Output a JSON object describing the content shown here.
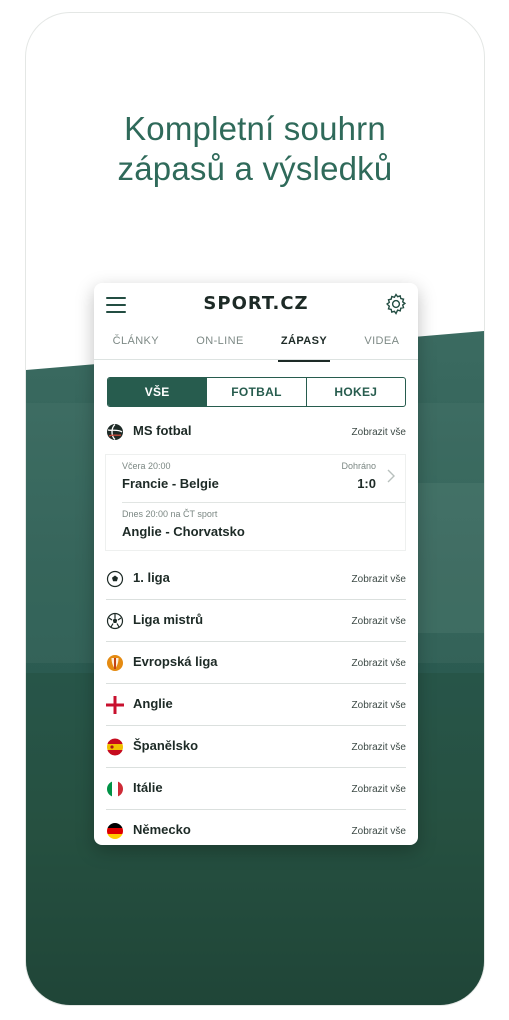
{
  "headline": {
    "line1": "Kompletní souhrn",
    "line2": "zápasů a výsledků"
  },
  "app": {
    "logo": "SPORT.CZ",
    "tabs": [
      {
        "label": "ČLÁNKY"
      },
      {
        "label": "ON-LINE"
      },
      {
        "label": "ZÁPASY"
      },
      {
        "label": "VIDEA"
      }
    ],
    "active_tab": "ZÁPASY",
    "segments": [
      {
        "label": "VŠE"
      },
      {
        "label": "FOTBAL"
      },
      {
        "label": "HOKEJ"
      }
    ],
    "active_segment": "VŠE",
    "featured": {
      "title": "MS fotbal",
      "link": "Zobrazit vše",
      "matches": [
        {
          "meta": "Včera 20:00",
          "teams": "Francie - Belgie",
          "status": "Dohráno",
          "score": "1:0"
        },
        {
          "meta": "Dnes 20:00 na ČT sport",
          "teams": "Anglie - Chorvatsko"
        }
      ]
    },
    "sections": [
      {
        "title": "1. liga",
        "link": "Zobrazit vše",
        "icon": "soccer-ball-icon"
      },
      {
        "title": "Liga mistrů",
        "link": "Zobrazit vše",
        "icon": "champions-ball-icon"
      },
      {
        "title": "Evropská liga",
        "link": "Zobrazit vše",
        "icon": "europa-league-icon"
      },
      {
        "title": "Anglie",
        "link": "Zobrazit vše",
        "icon": "england-flag-icon"
      },
      {
        "title": "Španělsko",
        "link": "Zobrazit vše",
        "icon": "spain-flag-icon"
      },
      {
        "title": "Itálie",
        "link": "Zobrazit vše",
        "icon": "italy-flag-icon"
      },
      {
        "title": "Německo",
        "link": "Zobrazit vše",
        "icon": "germany-flag-icon"
      }
    ]
  },
  "colors": {
    "brand_green": "#275c4e",
    "headline": "#2f6a5a",
    "text_dark": "#1d2a26"
  }
}
